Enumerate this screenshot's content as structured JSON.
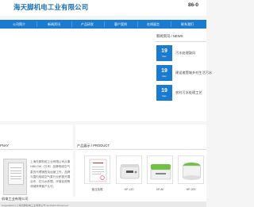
{
  "header": {
    "company_name": "海天脚机电工业有限公司",
    "phone": "86-0"
  },
  "nav": {
    "items": [
      {
        "label": "公司简介"
      },
      {
        "label": "新闻资讯"
      },
      {
        "label": "产品研发"
      },
      {
        "label": "客户案例"
      },
      {
        "label": "在线留言"
      },
      {
        "label": "联系我们"
      }
    ]
  },
  "news": {
    "title": "新闻资讯 / NEWS",
    "items": [
      {
        "day": "19",
        "ym": "Dec",
        "title": "污水处理鼓风"
      },
      {
        "day": "19",
        "ym": "Dec",
        "title": "建设诸暨城乡村生活污水"
      },
      {
        "day": "19",
        "ym": "Dec",
        "title": "农村污水处理工艺"
      }
    ]
  },
  "about": {
    "title": "PNAY",
    "text": "上海天脚机电工业有限公司从事HIBLOW（日本）品牌电磁空气泵的代理销售及运营工作，品牌与国内电磁空气泵行业积极开展合作，在污水处理、环境检测等领域获得客户认可。"
  },
  "products": {
    "title": "产品展示 / PRODUCT",
    "items": [
      {
        "caption": "营业执照"
      },
      {
        "caption": "HP-120"
      },
      {
        "caption": "XP-80"
      },
      {
        "caption": "HP-200"
      }
    ]
  },
  "contact": {
    "label": "机电工业有限公司"
  },
  "footer": {
    "copyright": "Copyright(C) 上海天脚机电工业有限公司 All Rights Reserved"
  },
  "colors": {
    "brand_blue": "#1a7bd0",
    "product_green": "#6fc23f"
  }
}
